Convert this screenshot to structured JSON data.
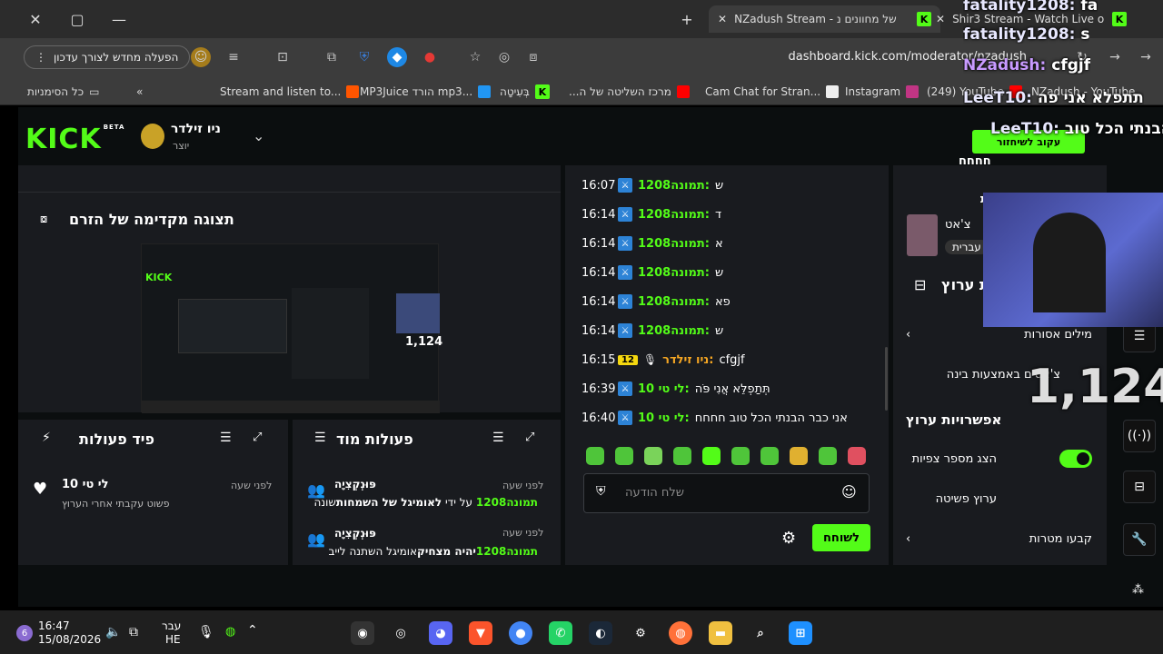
{
  "browser": {
    "tabs": [
      {
        "title": "NZadush Stream - של מחוונים נ"
      },
      {
        "title": "Shir3 Stream - Watch Live o"
      }
    ],
    "restart_label": "הפעלה מחדש לצורך עדכון",
    "url": "dashboard.kick.com/moderator/nzadush",
    "bookmarks": [
      {
        "label": "כל הסימניות"
      },
      {
        "label": "Stream and listen to..."
      },
      {
        "label": "MP3Juice הורד mp3..."
      },
      {
        "label": "בְּעִיטָה"
      },
      {
        "label": "...מרכז השליטה של ה"
      },
      {
        "label": "Cam Chat for Stran..."
      },
      {
        "label": "Instagram"
      },
      {
        "label": "(249) YouTube"
      },
      {
        "label": "NZadush - YouTube"
      }
    ]
  },
  "header": {
    "logo": "KICK",
    "beta": "BETA",
    "channel_name": "ניו זילדר",
    "channel_role": "יוצר"
  },
  "preview": {
    "title": "תצוגה מקדימה של הזרם",
    "viewers": "1,124"
  },
  "activity_feed": {
    "title": "פיד פעולות",
    "items": [
      {
        "user": "לי טי 10",
        "time": "לפני שעה",
        "text": "פשוט עקבתי אחרי הערוץ"
      }
    ]
  },
  "mod_actions": {
    "title": "פעולות מוד",
    "items": [
      {
        "type": "פּוּנְקְצִיָה",
        "time": "לפני שעה",
        "user": "תמונה1208",
        "text": "על ידי",
        "bold": "לאומיגל של השמחות",
        "tail": "שונה"
      },
      {
        "type": "פּוּנְקְצִיָה",
        "time": "לפני שעה",
        "user": "תמונה1208",
        "bold": "יהיה מצחיק",
        "tail": "אומיגל השתנה לייב"
      }
    ]
  },
  "chat": {
    "messages": [
      {
        "time": "16:07",
        "user": "תמונה1208",
        "text": "ש",
        "color": "#53fc18",
        "badge": "mod"
      },
      {
        "time": "16:14",
        "user": "תמונה1208",
        "text": "ד",
        "color": "#53fc18",
        "badge": "mod"
      },
      {
        "time": "16:14",
        "user": "תמונה1208",
        "text": "א",
        "color": "#53fc18",
        "badge": "mod"
      },
      {
        "time": "16:14",
        "user": "תמונה1208",
        "text": "ש",
        "color": "#53fc18",
        "badge": "mod"
      },
      {
        "time": "16:14",
        "user": "תמונה1208",
        "text": "פא",
        "color": "#53fc18",
        "badge": "mod"
      },
      {
        "time": "16:14",
        "user": "תמונה1208",
        "text": "ש",
        "color": "#53fc18",
        "badge": "mod"
      },
      {
        "time": "16:15",
        "user": "ניו זילדר",
        "text": "cfgjf",
        "color": "#f5a623",
        "badge": "owner",
        "badge_num": "12"
      },
      {
        "time": "16:39",
        "user": "לי טי 10",
        "text": "תְּתַפְלֵּא אֲנִי פֹּה",
        "color": "#53fc18",
        "badge": "mod"
      },
      {
        "time": "16:40",
        "user": "לי טי 10",
        "text": "אני כבר הבנתי הכל טוב חחחח",
        "color": "#53fc18",
        "badge": "mod"
      }
    ],
    "input_placeholder": "שלח הודעה",
    "send_label": "לשוחח"
  },
  "settings": {
    "partial_top": "חחחח",
    "game_title": "אומיגל של השמחות",
    "game_sub": "צ'אט",
    "game_lang": "עברית",
    "edit_title": "ת ערוץ",
    "banned_words": "מילים אסורות",
    "ai_chat": "צ'אטים באמצעות בינה",
    "options_title": "אפשרויות ערוץ",
    "show_viewers": "הצג מספר צפיות",
    "simple_channel": "ערוץ פשיטה",
    "goals": "קבעו מטרות",
    "big_viewers": "1,124"
  },
  "overlay": {
    "lines": [
      {
        "user": "fatality1208:",
        "text": "fa"
      },
      {
        "user": "fatality1208:",
        "text": "s"
      },
      {
        "user": "NZadush:",
        "text": "cfgjf"
      },
      {
        "user": "LeeT10:",
        "text": "תתפלא אני פה"
      },
      {
        "user": "LeeT10:",
        "text": "כבר הבנתי הכל טוב"
      }
    ],
    "follow_label": "עקוב לשיחזור"
  },
  "taskbar": {
    "time": "16:47",
    "date": "15/08/2026",
    "lang_top": "עבר",
    "lang_bottom": "HE",
    "notif": "6"
  }
}
